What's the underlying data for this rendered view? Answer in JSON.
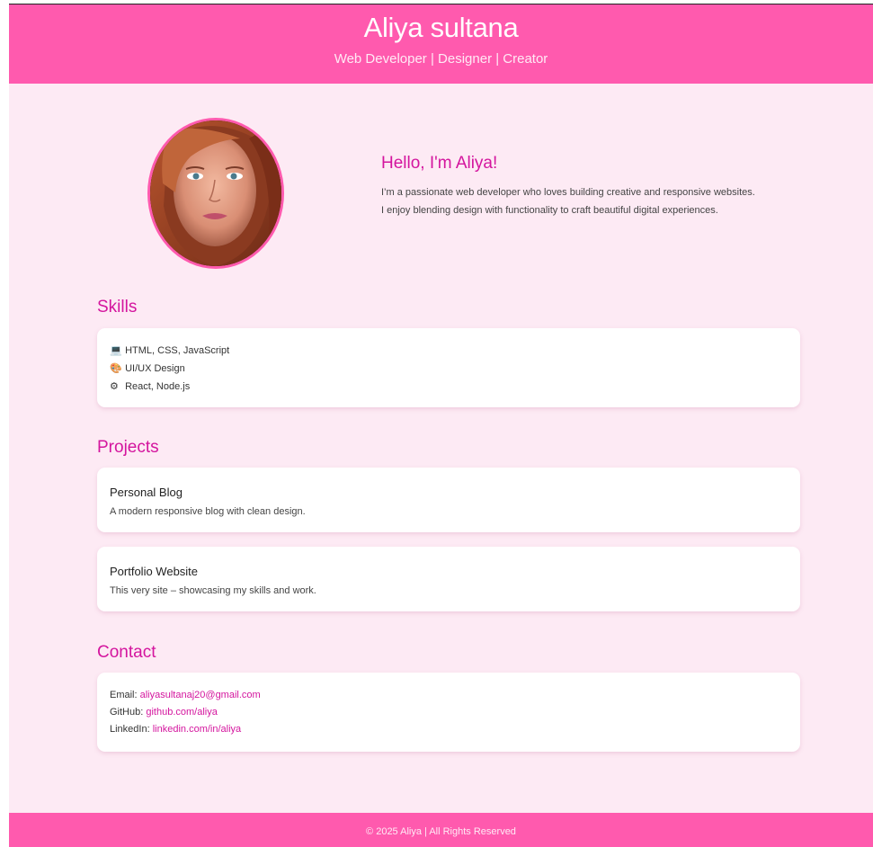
{
  "header": {
    "name": "Aliya sultana",
    "tagline": "Web Developer | Designer | Creator"
  },
  "about": {
    "heading": "Hello, I'm Aliya!",
    "text": "I’m a passionate web developer who loves building creative and responsive websites. I enjoy blending design with functionality to craft beautiful digital experiences."
  },
  "skills": {
    "title": "Skills",
    "items": [
      {
        "icon": "💻",
        "icon_name": "laptop-icon",
        "label": "HTML, CSS, JavaScript"
      },
      {
        "icon": "🎨",
        "icon_name": "palette-icon",
        "label": "UI/UX Design"
      },
      {
        "icon": "⚙",
        "icon_name": "gear-icon",
        "label": "React, Node.js"
      }
    ]
  },
  "projects": {
    "title": "Projects",
    "items": [
      {
        "title": "Personal Blog",
        "description": "A modern responsive blog with clean design."
      },
      {
        "title": "Portfolio Website",
        "description": "This very site – showcasing my skills and work."
      }
    ]
  },
  "contact": {
    "title": "Contact",
    "email_label": "Email:",
    "email": "aliyasultanaj20@gmail.com",
    "github_label": "GitHub:",
    "github": "github.com/aliya",
    "linkedin_label": "LinkedIn:",
    "linkedin": "linkedin.com/in/aliya"
  },
  "footer": {
    "text": "© 2025 Aliya | All Rights Reserved"
  },
  "colors": {
    "accent": "#ff5aae",
    "heading": "#d4159e",
    "background": "#fdeaf4"
  }
}
